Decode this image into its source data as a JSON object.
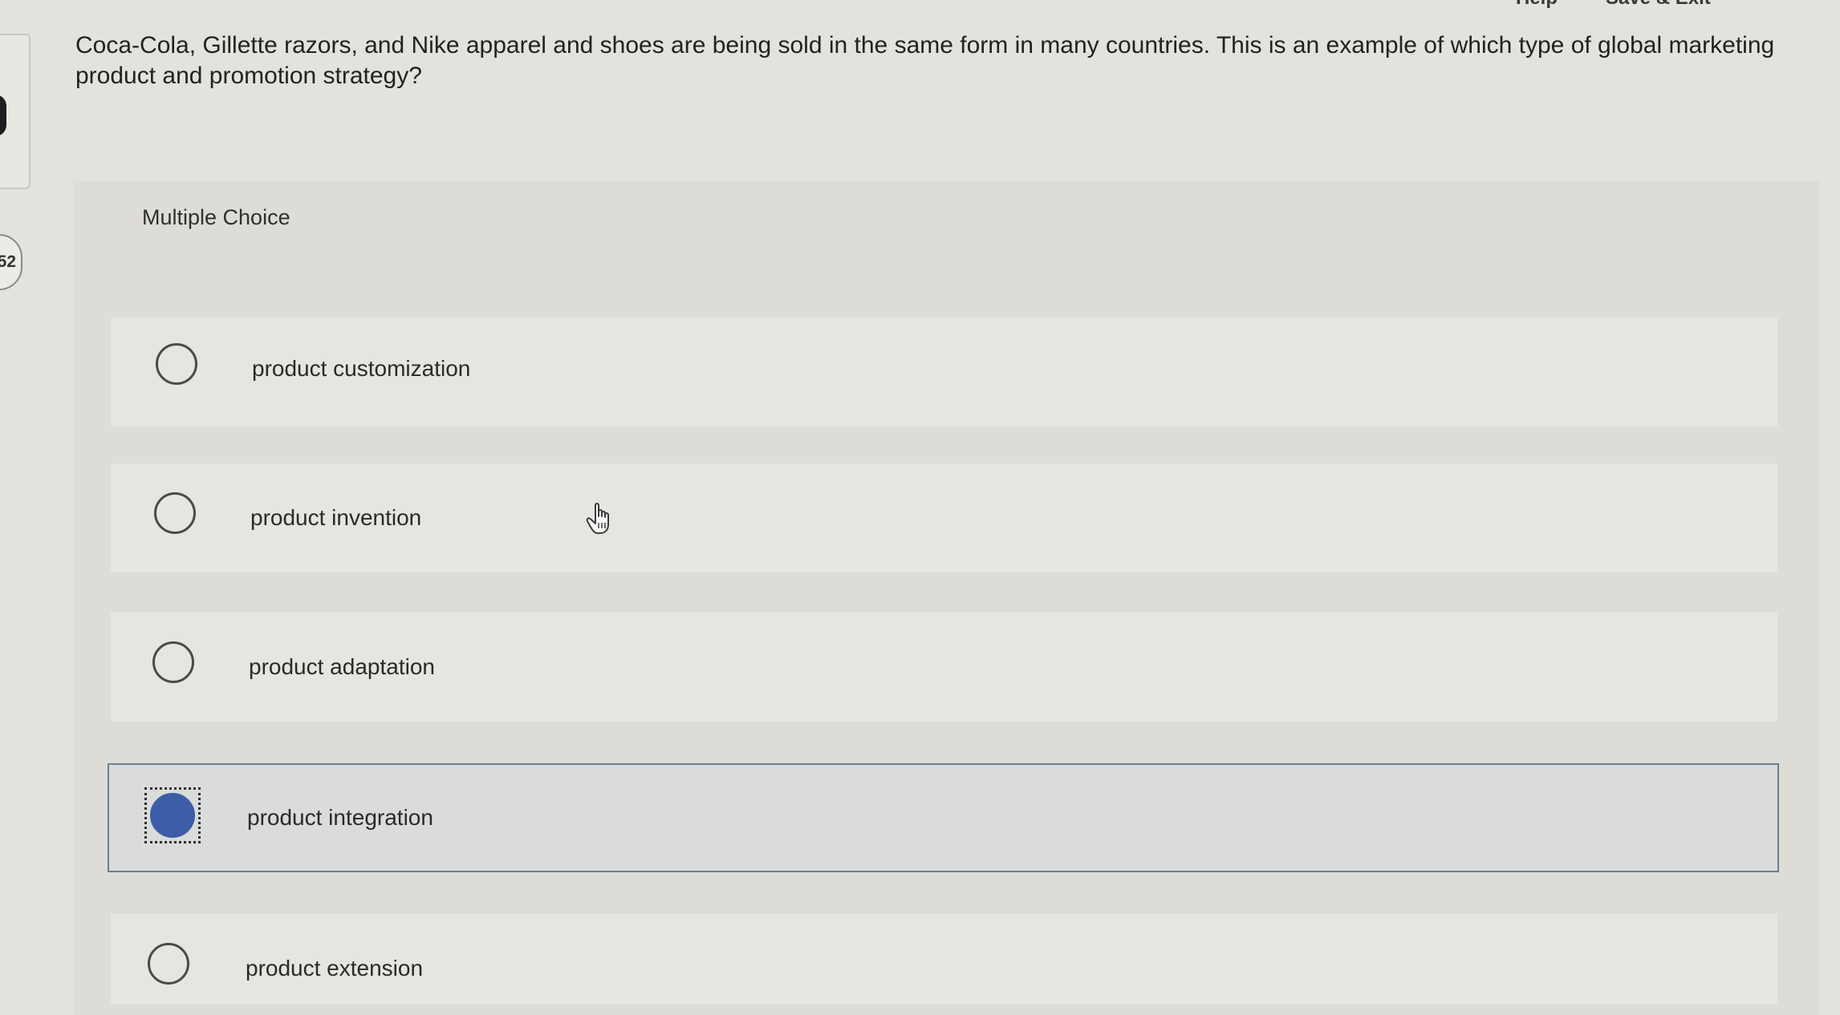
{
  "top_links": {
    "help": "Help",
    "save_exit": "Save & Exit"
  },
  "question_number": "52",
  "question_text": "Coca-Cola, Gillette razors, and Nike apparel and shoes are being sold in the same form in many countries. This is an example of which type of global marketing product and promotion strategy?",
  "question_type": "Multiple Choice",
  "options": [
    {
      "label": "product customization",
      "selected": false
    },
    {
      "label": "product invention",
      "selected": false
    },
    {
      "label": "product adaptation",
      "selected": false
    },
    {
      "label": "product integration",
      "selected": true
    },
    {
      "label": "product extension",
      "selected": false
    }
  ],
  "colors": {
    "selected_radio": "#3d5ea6",
    "selected_border": "#6e7f95"
  },
  "icons": {
    "cursor": "hand-pointer-icon",
    "radio": "radio-button-icon"
  }
}
